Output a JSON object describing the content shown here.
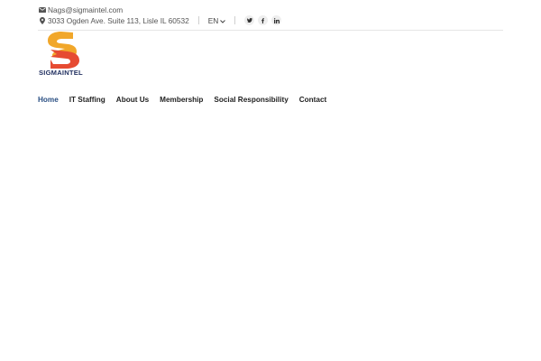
{
  "topbar": {
    "email": "Nags@sigmaintel.com",
    "address": "3033 Ogden Ave. Suite 113, Lisle IL 60532",
    "language": "EN",
    "icons": {
      "email": "envelope-icon",
      "address": "map-pin-icon",
      "language_dropdown": "chevron-down-icon"
    },
    "socials": [
      {
        "name": "twitter-icon",
        "glyph": "t"
      },
      {
        "name": "facebook-icon",
        "glyph": "f"
      },
      {
        "name": "linkedin-icon",
        "glyph": "in"
      }
    ]
  },
  "logo": {
    "text": "SIGMAINTEL",
    "colors": {
      "orange": "#f1a72a",
      "red": "#e64b32",
      "navy": "#233262"
    }
  },
  "nav": {
    "items": [
      {
        "label": "Home",
        "active": true
      },
      {
        "label": "IT Staffing",
        "active": false
      },
      {
        "label": "About Us",
        "active": false
      },
      {
        "label": "Membership",
        "active": false
      },
      {
        "label": "Social Responsibility",
        "active": false
      },
      {
        "label": "Contact",
        "active": false
      }
    ],
    "active_color": "#2a4f83"
  }
}
